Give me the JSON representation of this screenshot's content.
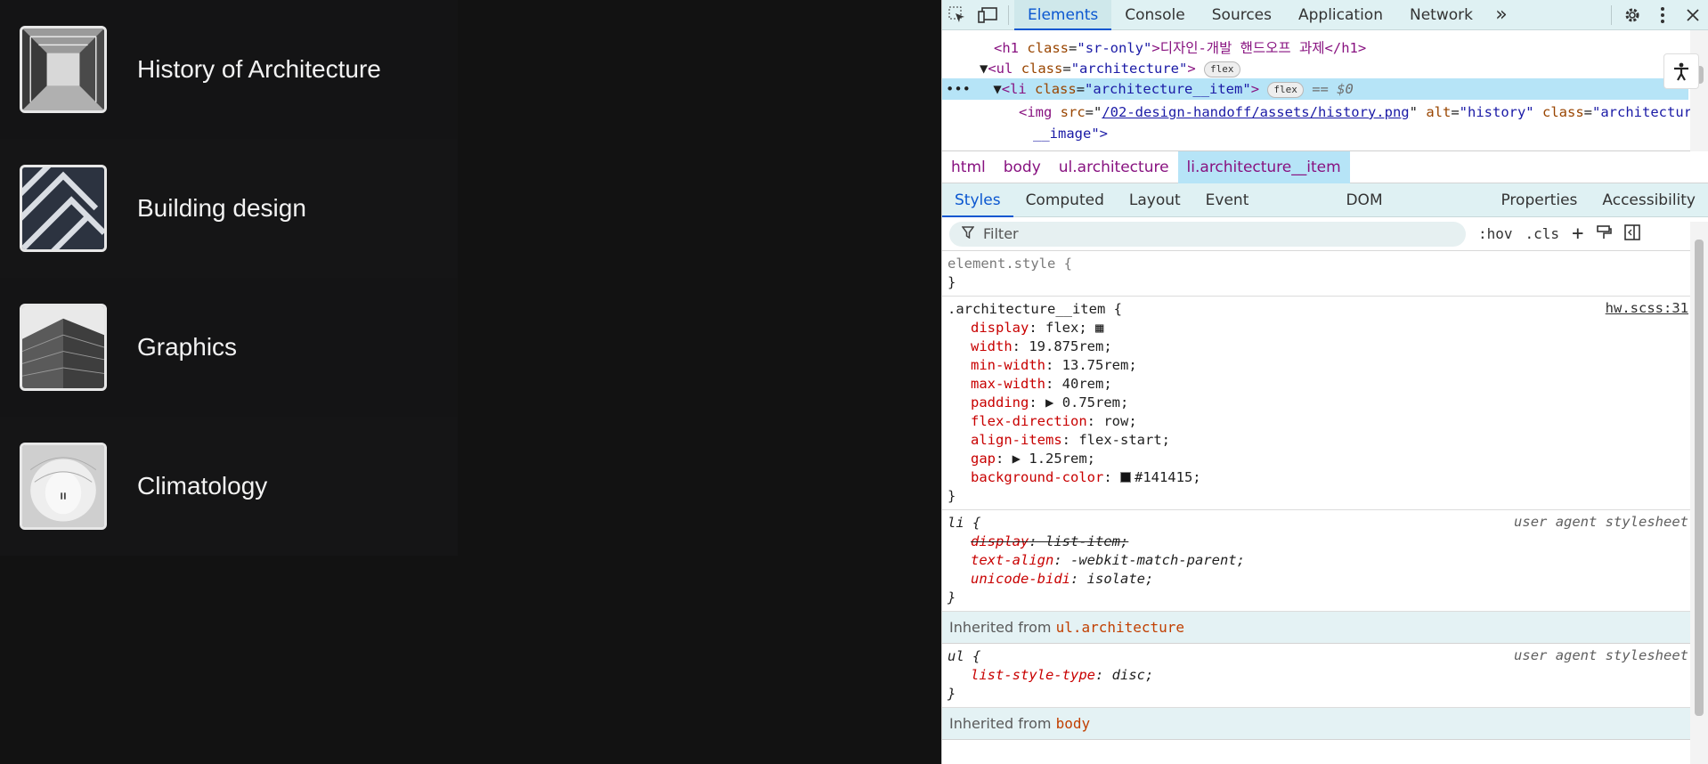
{
  "architecture": {
    "items": [
      {
        "title": "History of Architecture",
        "image": "history-thumbnail"
      },
      {
        "title": "Building design",
        "image": "building-thumbnail"
      },
      {
        "title": "Graphics",
        "image": "graphics-thumbnail"
      },
      {
        "title": "Climatology",
        "image": "climatology-thumbnail"
      }
    ]
  },
  "devtools": {
    "tabs": [
      "Elements",
      "Console",
      "Sources",
      "Application",
      "Network"
    ],
    "active_tab": "Elements",
    "more_tabs_label": "»",
    "dom": {
      "h1_open": "<h1",
      "h1_attr": "class",
      "h1_val": "\"sr-only\"",
      "h1_text": ">디자인-개발 핸드오프 과제</h1>",
      "ul_tag": "<ul",
      "ul_attr": "class",
      "ul_val": "\"architecture\"",
      "ul_pill": "flex",
      "li_tag": "<li",
      "li_attr": "class",
      "li_val": "\"architecture__item\"",
      "li_pill": "flex",
      "li_suffix": "== $0",
      "img_tag": "<img",
      "img_src_attr": "src",
      "img_src": "/02-design-handoff/assets/history.png",
      "img_alt_attr": "alt",
      "img_alt": "\"history\"",
      "img_class_attr": "class",
      "img_class_1": "\"architecture",
      "img_class_2": "__image\">"
    },
    "breadcrumbs": [
      "html",
      "body",
      "ul.architecture",
      "li.architecture__item"
    ],
    "subtabs": [
      "Styles",
      "Computed",
      "Layout",
      "Event Listeners",
      "DOM Breakpoints",
      "Properties",
      "Accessibility"
    ],
    "active_subtab": "Styles",
    "filter_placeholder": "Filter",
    "hov_label": ":hov",
    "cls_label": ".cls",
    "element_style": "element.style {",
    "rule1": {
      "selector": ".architecture__item {",
      "source": "hw.scss:31",
      "props": [
        {
          "name": "display",
          "value": "flex;"
        },
        {
          "name": "width",
          "value": "19.875rem;"
        },
        {
          "name": "min-width",
          "value": "13.75rem;"
        },
        {
          "name": "max-width",
          "value": "40rem;"
        },
        {
          "name": "padding",
          "value": "0.75rem;"
        },
        {
          "name": "flex-direction",
          "value": "row;"
        },
        {
          "name": "align-items",
          "value": "flex-start;"
        },
        {
          "name": "gap",
          "value": "1.25rem;"
        },
        {
          "name": "background-color",
          "value": "#141415;"
        }
      ]
    },
    "rule2": {
      "selector": "li {",
      "source": "user agent stylesheet",
      "props": [
        {
          "name": "display",
          "value": "list-item;"
        },
        {
          "name": "text-align",
          "value": "-webkit-match-parent;"
        },
        {
          "name": "unicode-bidi",
          "value": "isolate;"
        }
      ]
    },
    "inherited_1": {
      "label": "Inherited from",
      "ref": "ul.architecture"
    },
    "rule3": {
      "selector": "ul {",
      "source": "user agent stylesheet",
      "props": [
        {
          "name": "list-style-type",
          "value": "disc;"
        }
      ]
    },
    "inherited_2": {
      "label": "Inherited from",
      "ref": "body"
    },
    "close_brace": "}",
    "colors": {
      "accent": "#0b57d0",
      "item_bg": "#141415",
      "selection": "#b6e4f7"
    }
  }
}
